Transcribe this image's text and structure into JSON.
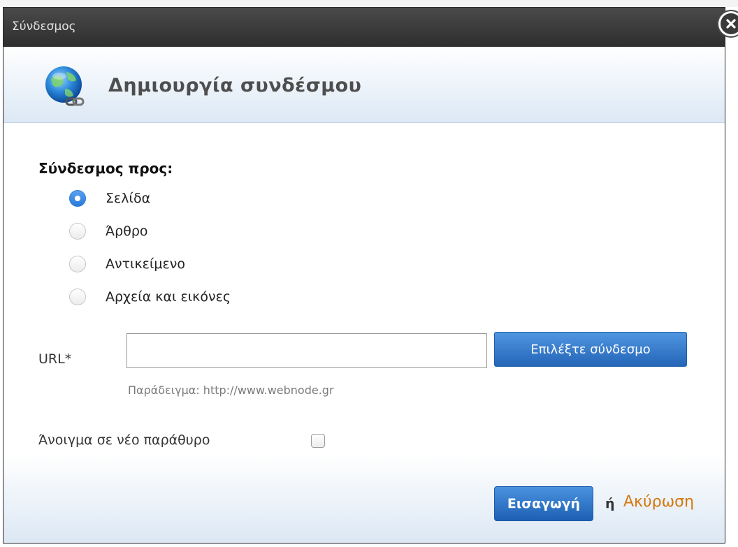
{
  "dialog": {
    "window_title": "Σύνδεσμος",
    "header_title": "Δημιουργία συνδέσμου"
  },
  "link_to": {
    "label": "Σύνδεσμος προς:",
    "options": [
      {
        "label": "Σελίδα",
        "checked": true
      },
      {
        "label": "Άρθρο",
        "checked": false
      },
      {
        "label": "Αντικείμενο",
        "checked": false
      },
      {
        "label": "Αρχεία και εικόνες",
        "checked": false
      }
    ]
  },
  "url": {
    "label": "URL*",
    "value": "",
    "placeholder": "",
    "choose_button": "Επιλέξτε σύνδεσμο",
    "example": "Παράδειγμα: http://www.webnode.gr"
  },
  "new_window": {
    "label": "Άνοιγμα σε νέο παράθυρο",
    "checked": false
  },
  "actions": {
    "insert": "Εισαγωγή",
    "or": "ή",
    "cancel": "Ακύρωση"
  },
  "colors": {
    "accent_blue": "#2b79da",
    "cancel_orange": "#d5770e",
    "titlebar": "#3a3a3a"
  },
  "icons": {
    "header": "globe-link-icon",
    "close": "close-icon"
  }
}
